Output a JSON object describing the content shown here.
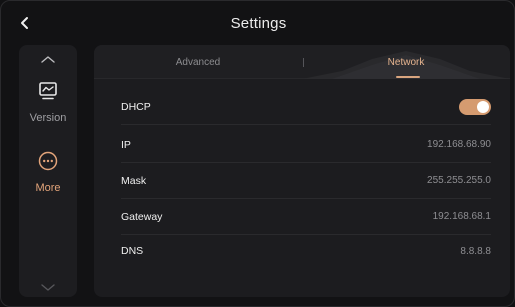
{
  "header": {
    "title": "Settings",
    "back_icon": "chevron-left-icon"
  },
  "sidebar": {
    "items": [
      {
        "label": "Version",
        "icon": "monitor-icon"
      },
      {
        "label": "More",
        "icon": "more-dots-icon"
      }
    ]
  },
  "tabs": [
    {
      "label": "Advanced",
      "active": false
    },
    {
      "label": "Network",
      "active": true
    }
  ],
  "network": {
    "dhcp": {
      "label": "DHCP",
      "enabled": true
    },
    "ip": {
      "label": "IP",
      "value": "192.168.68.90"
    },
    "mask": {
      "label": "Mask",
      "value": "255.255.255.0"
    },
    "gateway": {
      "label": "Gateway",
      "value": "192.168.68.1"
    },
    "dns": {
      "label": "DNS",
      "value": "8.8.8.8"
    }
  },
  "colors": {
    "accent": "#d59b70",
    "accent_text": "#e2a47a",
    "background": "#121214",
    "panel": "#1c1c1f"
  }
}
